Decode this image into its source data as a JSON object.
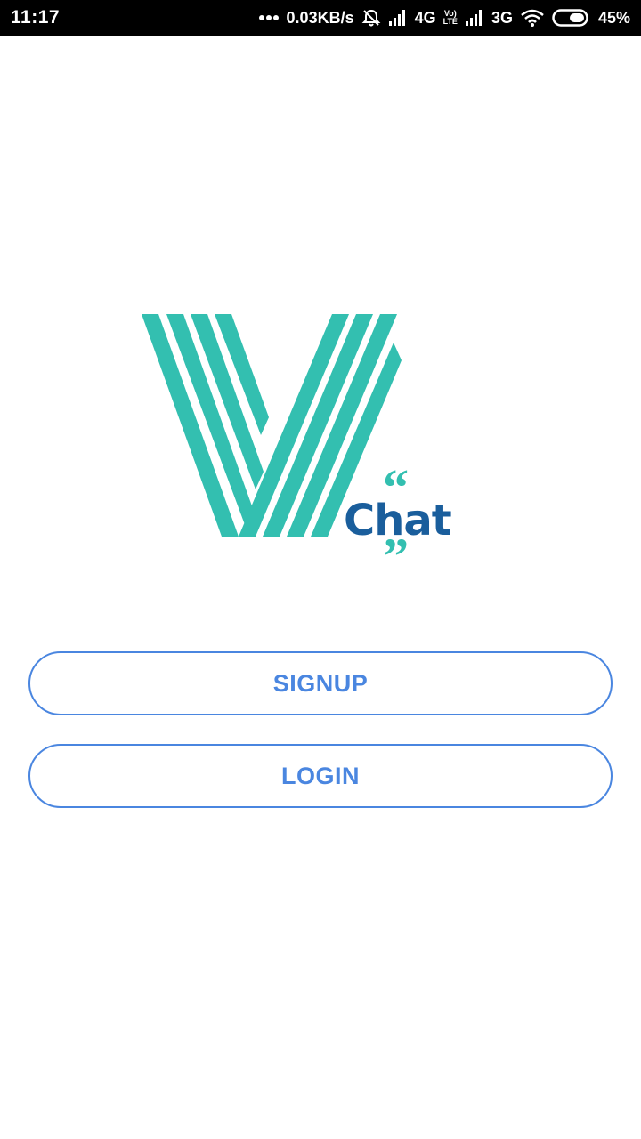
{
  "status_bar": {
    "time": "11:17",
    "net_speed": "0.03KB/s",
    "network_1": "4G",
    "volte_top": "Vo)",
    "volte_bottom": "LTE",
    "network_2": "3G",
    "battery": "45%",
    "icons": [
      "dots-icon",
      "mute-icon",
      "signal-icon",
      "signal-icon",
      "wifi-icon",
      "battery-icon"
    ]
  },
  "logo": {
    "wordmark": "Chat",
    "colors": {
      "teal": "#33bfb0",
      "blue": "#1a5e9c"
    }
  },
  "buttons": {
    "signup_label": "SIGNUP",
    "login_label": "LOGIN",
    "accent_color": "#4a86e0"
  }
}
